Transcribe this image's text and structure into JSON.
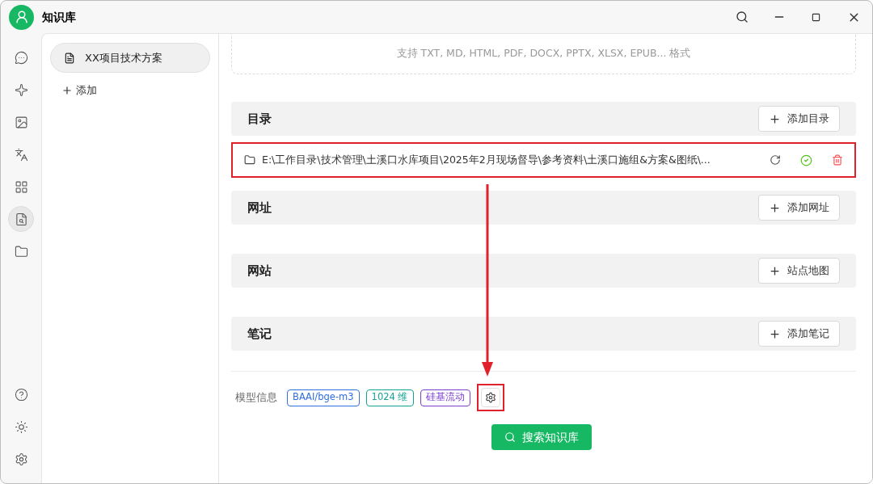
{
  "window": {
    "title": "知识库"
  },
  "nav": [
    {
      "kind": "chat",
      "selected": false
    },
    {
      "kind": "assistant",
      "selected": false
    },
    {
      "kind": "image",
      "selected": false
    },
    {
      "kind": "translate",
      "selected": false
    },
    {
      "kind": "apps",
      "selected": false
    },
    {
      "kind": "knowledge",
      "selected": true
    },
    {
      "kind": "files",
      "selected": false
    }
  ],
  "nav_bottom": [
    {
      "kind": "help"
    },
    {
      "kind": "theme"
    },
    {
      "kind": "settings"
    }
  ],
  "knowledge_bases": [
    {
      "name": "XX项目技术方案",
      "selected": true
    }
  ],
  "add_label": "添加",
  "upload_hint": "支持 TXT, MD, HTML, PDF, DOCX, PPTX, XLSX, EPUB... 格式",
  "sections": [
    {
      "title": "目录",
      "button": "添加目录",
      "entries": [
        {
          "path": "E:\\工作目录\\技术管理\\土溪口水库项目\\2025年2月现场督导\\参考资料\\土溪口施组&方案&图纸\\...",
          "highlighted": true
        }
      ]
    },
    {
      "title": "网址",
      "button": "添加网址"
    },
    {
      "title": "网站",
      "button": "站点地图"
    },
    {
      "title": "笔记",
      "button": "添加笔记"
    }
  ],
  "model_info": {
    "label": "模型信息",
    "tags": [
      {
        "text": "BAAI/bge-m3",
        "color": "#2f6fe0"
      },
      {
        "text": "1024 维",
        "color": "#13a394"
      },
      {
        "text": "硅基流动",
        "color": "#7b3fd0"
      }
    ],
    "settings_highlighted": true
  },
  "search_button": "搜索知识库"
}
